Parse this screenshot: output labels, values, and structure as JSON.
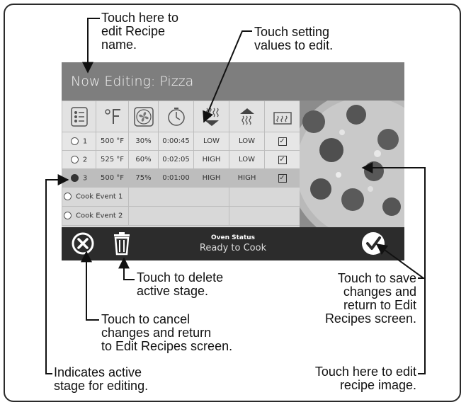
{
  "header": {
    "title": "Now Editing: Pizza"
  },
  "columns": [
    {
      "icon": "list-icon"
    },
    {
      "icon": "fahrenheit-icon"
    },
    {
      "icon": "fan-icon"
    },
    {
      "icon": "timer-icon"
    },
    {
      "icon": "bottom-heat-icon"
    },
    {
      "icon": "top-heat-icon"
    },
    {
      "icon": "heater-element-icon"
    }
  ],
  "stages": [
    {
      "num": "1",
      "temp": "500 °F",
      "fan": "30%",
      "time": "0:00:45",
      "bottom": "LOW",
      "top": "LOW",
      "element": "☑",
      "active": false
    },
    {
      "num": "2",
      "temp": "525 °F",
      "fan": "60%",
      "time": "0:02:05",
      "bottom": "HIGH",
      "top": "LOW",
      "element": "☑",
      "active": false
    },
    {
      "num": "3",
      "temp": "500 °F",
      "fan": "75%",
      "time": "0:01:00",
      "bottom": "HIGH",
      "top": "HIGH",
      "element": "☑",
      "active": true
    }
  ],
  "events": [
    {
      "label": "Cook Event 1"
    },
    {
      "label": "Cook Event 2"
    }
  ],
  "status": {
    "title": "Oven Status",
    "text": "Ready to Cook"
  },
  "callouts": {
    "recipe_name": "Touch here to\nedit Recipe\nname.",
    "setting_values": "Touch setting\nvalues to edit.",
    "delete_stage": "Touch to delete\nactive stage.",
    "cancel_changes": "Touch to cancel\nchanges and return\nto Edit Recipes screen.",
    "active_stage": "Indicates active\nstage for editing.",
    "save_changes": "Touch to save\nchanges and\nreturn to Edit\nRecipes screen.",
    "recipe_image": "Touch here to edit\nrecipe image."
  },
  "colors": {
    "header_bg": "#7e7e7e",
    "status_bg": "#2c2c2c",
    "active_row": "#bdbdbd"
  }
}
